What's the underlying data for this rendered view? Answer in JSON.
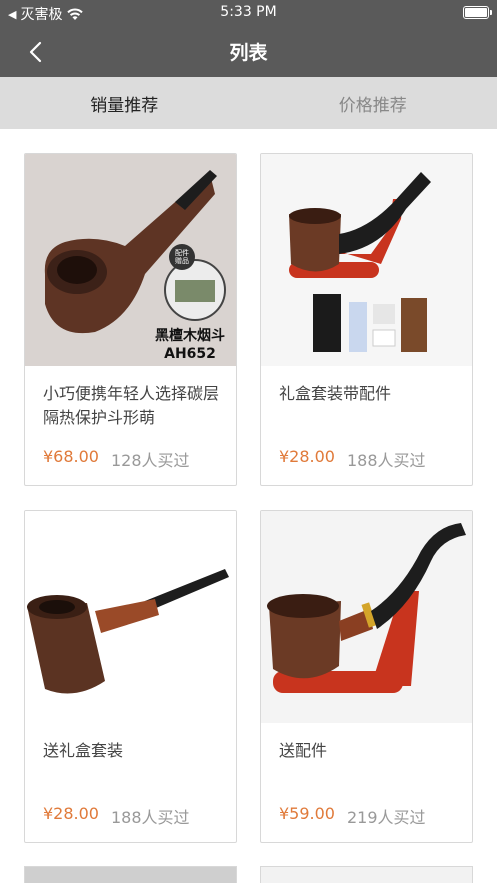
{
  "status": {
    "carrier": "灭害极",
    "time": "5:33 PM"
  },
  "nav": {
    "title": "列表"
  },
  "tabs": [
    {
      "label": "销量推荐"
    },
    {
      "label": "价格推荐"
    }
  ],
  "products": [
    {
      "name": "小巧便携年轻人选择碳层隔热保护斗形萌",
      "price": "¥68.00",
      "sold": "128人买过",
      "img_text_1": "黑檀木烟斗",
      "img_text_2": "AH652",
      "img_text_3": "配件",
      "img_text_4": "赠品"
    },
    {
      "name": "礼盒套装带配件",
      "price": "¥28.00",
      "sold": "188人买过"
    },
    {
      "name": "送礼盒套装",
      "price": "¥28.00",
      "sold": "188人买过"
    },
    {
      "name": "送配件",
      "price": "¥59.00",
      "sold": "219人买过"
    }
  ],
  "colors": {
    "bar": "#5a5a5a",
    "tab_bg": "#dcdcdc",
    "price": "#e07a3a",
    "wood": "#6b3a25"
  }
}
